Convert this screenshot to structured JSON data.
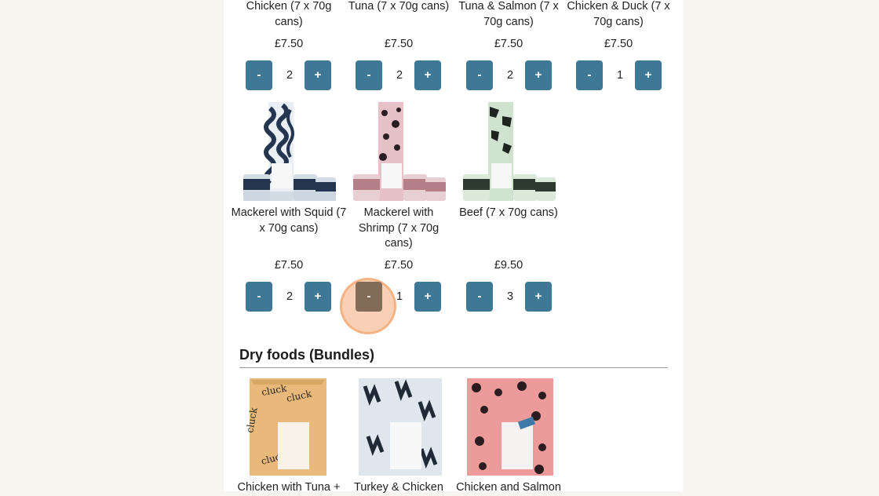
{
  "colors": {
    "button": "#3f7895",
    "button_pressed": "#826b57",
    "page_bg": "#f6f5f0",
    "panel_bg": "#ffffff",
    "click_indicator": "#f4aa78"
  },
  "wet_row1": [
    {
      "title": "Chicken (7 x 70g cans)",
      "price": "£7.50",
      "qty": "2",
      "minus": "-",
      "plus": "+"
    },
    {
      "title": "Tuna (7 x 70g cans)",
      "price": "£7.50",
      "qty": "2",
      "minus": "-",
      "plus": "+"
    },
    {
      "title": "Tuna & Salmon (7 x 70g cans)",
      "price": "£7.50",
      "qty": "2",
      "minus": "-",
      "plus": "+"
    },
    {
      "title": "Chicken & Duck (7 x 70g cans)",
      "price": "£7.50",
      "qty": "1",
      "minus": "-",
      "plus": "+"
    }
  ],
  "wet_row2": [
    {
      "title": "Mackerel with Squid (7 x 70g cans)",
      "price": "£7.50",
      "qty": "2",
      "minus": "-",
      "plus": "+"
    },
    {
      "title": "Mackerel with Shrimp (7 x 70g cans)",
      "price": "£7.50",
      "qty": "1",
      "minus": "-",
      "plus": "+"
    },
    {
      "title": "Beef (7 x 70g cans)",
      "price": "£9.50",
      "qty": "3",
      "minus": "-",
      "plus": "+"
    }
  ],
  "dry_section": {
    "heading": "Dry foods (Bundles)",
    "items": [
      {
        "title": "Chicken with Tuna +"
      },
      {
        "title": "Turkey & Chicken"
      },
      {
        "title": "Chicken and Salmon"
      }
    ]
  }
}
